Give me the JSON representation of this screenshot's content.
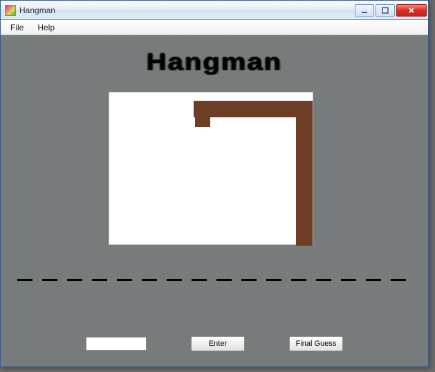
{
  "window": {
    "title": "Hangman"
  },
  "menu": {
    "file": "File",
    "help": "Help"
  },
  "game": {
    "title": "Hangman",
    "letter_slots": 16,
    "guess_value": "",
    "enter_label": "Enter",
    "final_guess_label": "Final Guess"
  },
  "colors": {
    "client_bg": "#777b7b",
    "gallows": "#6e3d26"
  }
}
